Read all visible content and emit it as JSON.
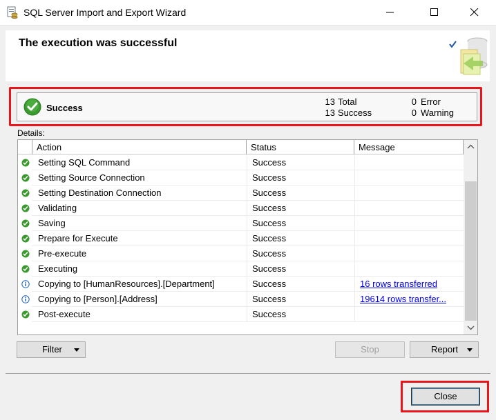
{
  "window": {
    "title": "SQL Server Import and Export Wizard"
  },
  "header": {
    "title": "The execution was successful"
  },
  "summary": {
    "status_label": "Success",
    "total_count": "13",
    "total_label": "Total",
    "success_count": "13",
    "success_label": "Success",
    "error_count": "0",
    "error_label": "Error",
    "warning_count": "0",
    "warning_label": "Warning"
  },
  "details": {
    "label": "Details:",
    "columns": [
      "Action",
      "Status",
      "Message"
    ],
    "rows": [
      {
        "icon": "success-icon",
        "action": "Setting SQL Command",
        "status": "Success",
        "message": ""
      },
      {
        "icon": "success-icon",
        "action": "Setting Source Connection",
        "status": "Success",
        "message": ""
      },
      {
        "icon": "success-icon",
        "action": "Setting Destination Connection",
        "status": "Success",
        "message": ""
      },
      {
        "icon": "success-icon",
        "action": "Validating",
        "status": "Success",
        "message": ""
      },
      {
        "icon": "success-icon",
        "action": "Saving",
        "status": "Success",
        "message": ""
      },
      {
        "icon": "success-icon",
        "action": "Prepare for Execute",
        "status": "Success",
        "message": ""
      },
      {
        "icon": "success-icon",
        "action": "Pre-execute",
        "status": "Success",
        "message": ""
      },
      {
        "icon": "success-icon",
        "action": "Executing",
        "status": "Success",
        "message": ""
      },
      {
        "icon": "info-icon",
        "action": "Copying to [HumanResources].[Department]",
        "status": "Success",
        "message": "16 rows transferred"
      },
      {
        "icon": "info-icon",
        "action": "Copying to [Person].[Address]",
        "status": "Success",
        "message": "19614 rows transfer..."
      },
      {
        "icon": "success-icon",
        "action": "Post-execute",
        "status": "Success",
        "message": ""
      }
    ]
  },
  "buttons": {
    "filter": "Filter",
    "stop": "Stop",
    "report": "Report",
    "close": "Close"
  },
  "colors": {
    "highlight": "#e8151b",
    "success_green": "#3a9a2e",
    "info_blue": "#1a5fb4",
    "link": "#0000ee"
  }
}
